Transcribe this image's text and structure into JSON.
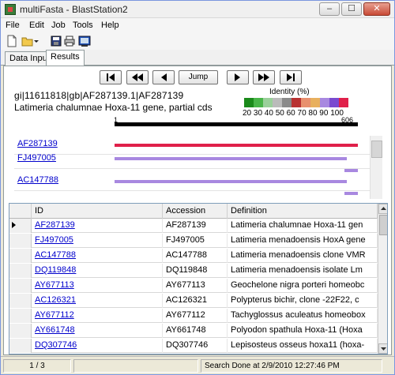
{
  "window": {
    "title": "multiFasta - BlastStation2"
  },
  "window_controls": {
    "minimize": "–",
    "maximize": "☐",
    "close": "✕"
  },
  "menu": [
    "File",
    "Edit",
    "Job",
    "Tools",
    "Help"
  ],
  "toolbar_icons": [
    "new-document-icon",
    "open-folder-icon",
    "save-icon",
    "print-icon",
    "properties-icon"
  ],
  "tabs": [
    "Data Input",
    "Results"
  ],
  "navigation": {
    "jump_label": "Jump"
  },
  "query": {
    "id_line": "gi|11611818|gb|AF287139.1|AF287139",
    "description": "Latimeria chalumnae Hoxa-11 gene, partial cds",
    "length_start": "1",
    "length_end": "606"
  },
  "identity_legend": {
    "label": "Identity (%)",
    "colors": [
      "#1a8a1a",
      "#48b548",
      "#9ad09a",
      "#bbbbbb",
      "#8a8a8a",
      "#b83232",
      "#e8906e",
      "#e8b05e",
      "#a888e0",
      "#7a4ad0",
      "#e0204a"
    ],
    "ticks": "20 30 40 50 60 70 80 90 100"
  },
  "hits": [
    {
      "id": "AF287139",
      "color": "#e0204a"
    },
    {
      "id": "FJ497005",
      "color": "#a888e0"
    },
    {
      "id": "AC147788",
      "color": "#a888e0"
    }
  ],
  "table": {
    "columns": [
      "ID",
      "Accession",
      "Definition"
    ],
    "rows": [
      {
        "id": "AF287139",
        "accession": "AF287139",
        "definition": "Latimeria chalumnae Hoxa-11 gen"
      },
      {
        "id": "FJ497005",
        "accession": "FJ497005",
        "definition": "Latimeria menadoensis HoxA gene"
      },
      {
        "id": "AC147788",
        "accession": "AC147788",
        "definition": "Latimeria menadoensis clone VMR"
      },
      {
        "id": "DQ119848",
        "accession": "DQ119848",
        "definition": "Latimeria menadoensis isolate Lm"
      },
      {
        "id": "AY677113",
        "accession": "AY677113",
        "definition": "Geochelone nigra porteri homeobc"
      },
      {
        "id": "AC126321",
        "accession": "AC126321",
        "definition": "Polypterus bichir, clone -22F22, c"
      },
      {
        "id": "AY677112",
        "accession": "AY677112",
        "definition": "Tachyglossus aculeatus homeobox"
      },
      {
        "id": "AY661748",
        "accession": "AY661748",
        "definition": "Polyodon spathula Hoxa-11 (Hoxa"
      },
      {
        "id": "DQ307746",
        "accession": "DQ307746",
        "definition": "Lepisosteus osseus hoxa11 (hoxa-"
      }
    ]
  },
  "status": {
    "page": "1 / 3",
    "job": "Search Done at  2/9/2010 12:27:46 PM"
  }
}
